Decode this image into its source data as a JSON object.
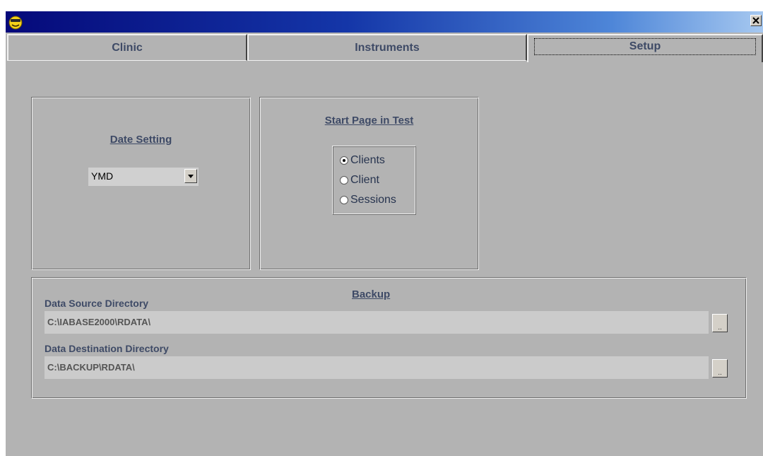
{
  "window": {
    "app_icon": "smiley-face-icon",
    "close_icon": "close-x-icon"
  },
  "tabs": [
    {
      "label": "Clinic",
      "selected": false
    },
    {
      "label": "Instruments",
      "selected": false
    },
    {
      "label": "Setup",
      "selected": true
    }
  ],
  "date_setting": {
    "heading": "Date Setting",
    "selected_value": "YMD",
    "dropdown_icon": "chevron-down-icon"
  },
  "start_page": {
    "heading": "Start Page in Test",
    "options": [
      {
        "label": "Clients",
        "checked": true
      },
      {
        "label": "Client",
        "checked": false
      },
      {
        "label": "Sessions",
        "checked": false
      }
    ]
  },
  "backup": {
    "heading": "Backup",
    "source": {
      "label": "Data Source Directory",
      "value": "C:\\IABASE2000\\RDATA\\",
      "browse_label": ".."
    },
    "destination": {
      "label": "Data Destination Directory",
      "value": "C:\\BACKUP\\RDATA\\",
      "browse_label": ".."
    }
  },
  "colors": {
    "background": "#b3b3b3",
    "heading_text": "#3e4a66",
    "titlebar_start": "#05097a",
    "titlebar_end": "#a6c8f0"
  }
}
